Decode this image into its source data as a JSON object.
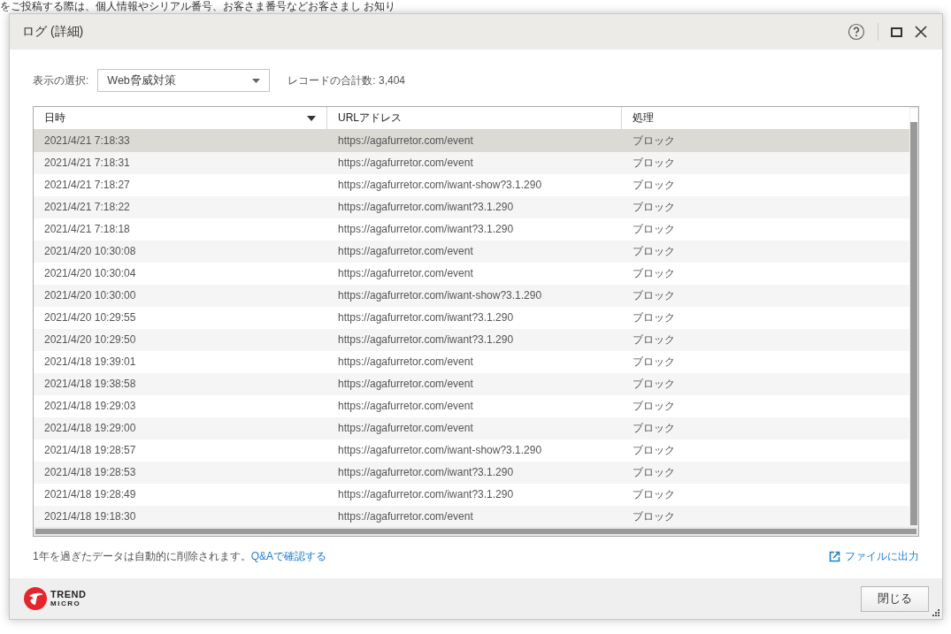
{
  "background_page": {
    "text": "をご投稿する際は、個人情報やシリアル番号、お客さま番号などお客さまし お知り"
  },
  "window": {
    "title": "ログ (詳細)"
  },
  "filter": {
    "label": "表示の選択:",
    "value": "Web脅威対策"
  },
  "record_count": "レコードの合計数: 3,404",
  "table": {
    "columns": [
      {
        "label": "日時",
        "sorted": true
      },
      {
        "label": "URLアドレス",
        "sorted": false
      },
      {
        "label": "処理",
        "sorted": false
      }
    ],
    "rows": [
      {
        "cells": [
          "2021/4/21 7:18:33",
          "https://agafurretor.com/event",
          "ブロック"
        ],
        "selected": true
      },
      {
        "cells": [
          "2021/4/21 7:18:31",
          "https://agafurretor.com/event",
          "ブロック"
        ],
        "selected": false
      },
      {
        "cells": [
          "2021/4/21 7:18:27",
          "https://agafurretor.com/iwant-show?3.1.290",
          "ブロック"
        ],
        "selected": false
      },
      {
        "cells": [
          "2021/4/21 7:18:22",
          "https://agafurretor.com/iwant?3.1.290",
          "ブロック"
        ],
        "selected": false
      },
      {
        "cells": [
          "2021/4/21 7:18:18",
          "https://agafurretor.com/iwant?3.1.290",
          "ブロック"
        ],
        "selected": false
      },
      {
        "cells": [
          "2021/4/20 10:30:08",
          "https://agafurretor.com/event",
          "ブロック"
        ],
        "selected": false
      },
      {
        "cells": [
          "2021/4/20 10:30:04",
          "https://agafurretor.com/event",
          "ブロック"
        ],
        "selected": false
      },
      {
        "cells": [
          "2021/4/20 10:30:00",
          "https://agafurretor.com/iwant-show?3.1.290",
          "ブロック"
        ],
        "selected": false
      },
      {
        "cells": [
          "2021/4/20 10:29:55",
          "https://agafurretor.com/iwant?3.1.290",
          "ブロック"
        ],
        "selected": false
      },
      {
        "cells": [
          "2021/4/20 10:29:50",
          "https://agafurretor.com/iwant?3.1.290",
          "ブロック"
        ],
        "selected": false
      },
      {
        "cells": [
          "2021/4/18 19:39:01",
          "https://agafurretor.com/event",
          "ブロック"
        ],
        "selected": false
      },
      {
        "cells": [
          "2021/4/18 19:38:58",
          "https://agafurretor.com/event",
          "ブロック"
        ],
        "selected": false
      },
      {
        "cells": [
          "2021/4/18 19:29:03",
          "https://agafurretor.com/event",
          "ブロック"
        ],
        "selected": false
      },
      {
        "cells": [
          "2021/4/18 19:29:00",
          "https://agafurretor.com/event",
          "ブロック"
        ],
        "selected": false
      },
      {
        "cells": [
          "2021/4/18 19:28:57",
          "https://agafurretor.com/iwant-show?3.1.290",
          "ブロック"
        ],
        "selected": false
      },
      {
        "cells": [
          "2021/4/18 19:28:53",
          "https://agafurretor.com/iwant?3.1.290",
          "ブロック"
        ],
        "selected": false
      },
      {
        "cells": [
          "2021/4/18 19:28:49",
          "https://agafurretor.com/iwant?3.1.290",
          "ブロック"
        ],
        "selected": false
      },
      {
        "cells": [
          "2021/4/18 19:18:30",
          "https://agafurretor.com/event",
          "ブロック"
        ],
        "selected": false
      }
    ]
  },
  "footer": {
    "note": "1年を過ぎたデータは自動的に削除されます。",
    "link": "Q&Aで確認する",
    "export": "ファイルに出力"
  },
  "logo": {
    "line1": "TREND",
    "line2": "MICRO"
  },
  "buttons": [
    "閉じる"
  ]
}
